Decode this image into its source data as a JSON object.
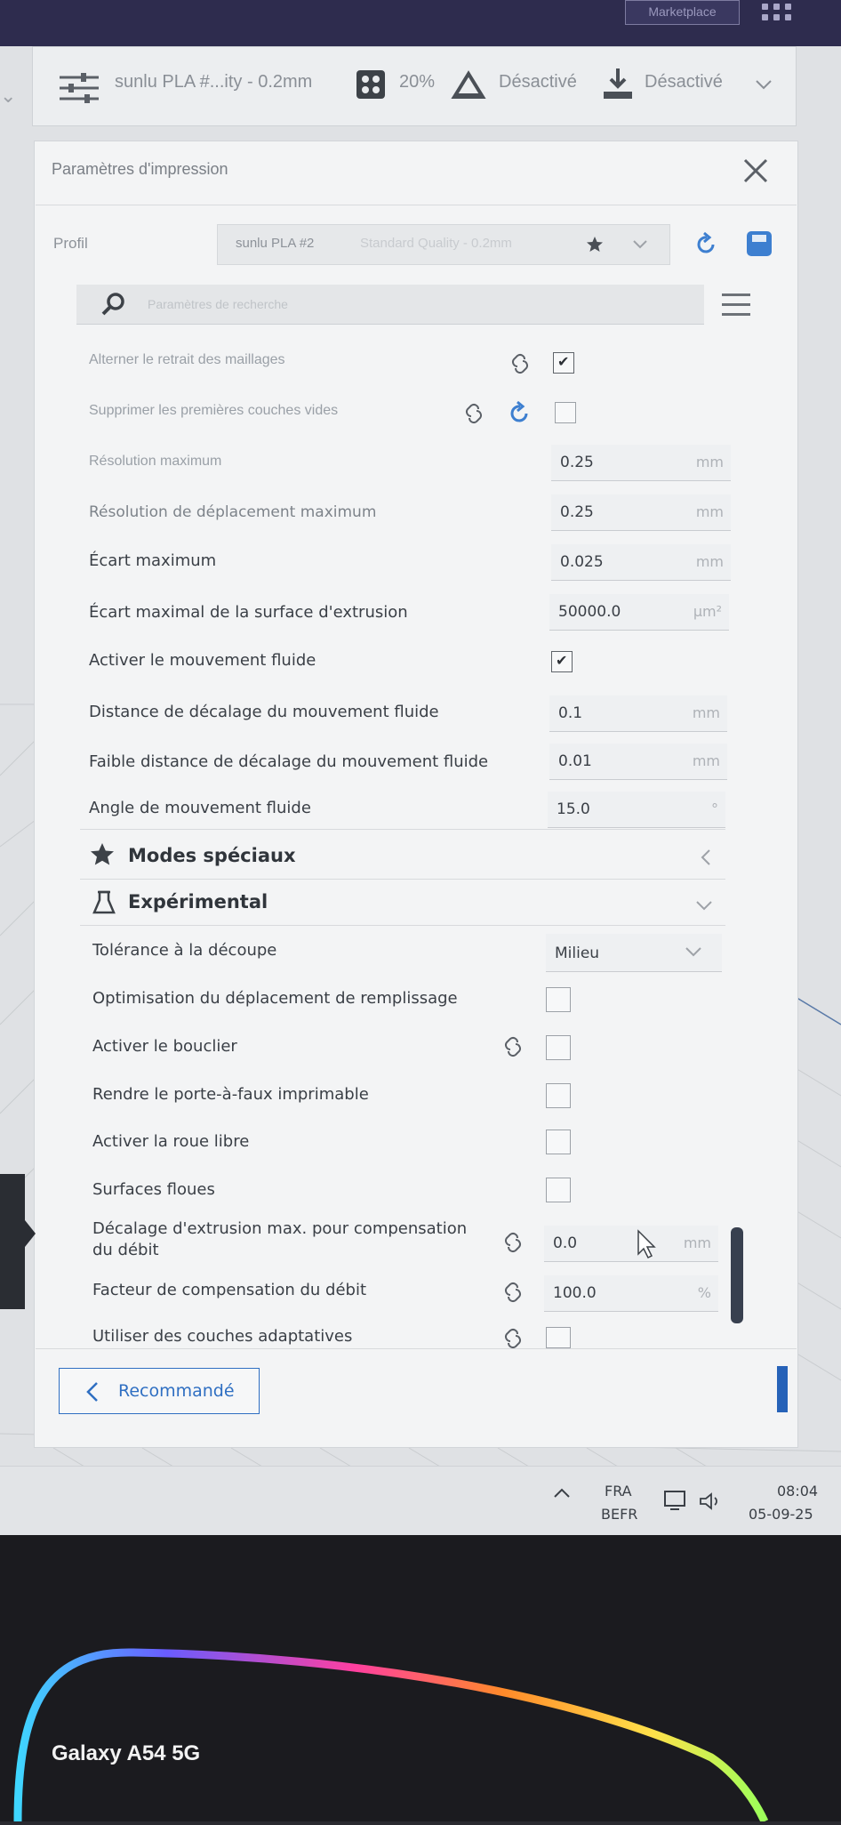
{
  "topbar": {
    "marketplace_label": "Marketplace"
  },
  "header": {
    "profile_summary": "sunlu PLA #...ity - 0.2mm",
    "infill": "20%",
    "support": "Désactivé",
    "adhesion": "Désactivé"
  },
  "panel": {
    "title": "Paramètres d'impression",
    "profile_label": "Profil",
    "profile_value": "sunlu PLA #2",
    "profile_quality": "Standard Quality - 0.2mm",
    "search_placeholder": "Paramètres de recherche"
  },
  "settings": [
    {
      "label": "Alterner le retrait des maillages",
      "checked": true
    },
    {
      "label": "Supprimer les premières couches vides",
      "checked": false
    },
    {
      "label": "Résolution maximum",
      "value": "0.25",
      "unit": "mm"
    },
    {
      "label": "Résolution de déplacement maximum",
      "value": "0.25",
      "unit": "mm"
    },
    {
      "label": "Écart maximum",
      "value": "0.025",
      "unit": "mm"
    },
    {
      "label": "Écart maximal de la surface d'extrusion",
      "value": "50000.0",
      "unit": "µm²"
    },
    {
      "label": "Activer le mouvement fluide",
      "checked": true
    },
    {
      "label": "Distance de décalage du mouvement fluide",
      "value": "0.1",
      "unit": "mm"
    },
    {
      "label": "Faible distance de décalage du mouvement fluide",
      "value": "0.01",
      "unit": "mm"
    },
    {
      "label": "Angle de mouvement fluide",
      "value": "15.0",
      "unit": "°"
    }
  ],
  "sections": {
    "special": "Modes spéciaux",
    "experimental": "Expérimental"
  },
  "experimental": [
    {
      "label": "Tolérance à la découpe",
      "value": "Milieu"
    },
    {
      "label": "Optimisation du déplacement de remplissage",
      "checked": false
    },
    {
      "label": "Activer le bouclier",
      "checked": false
    },
    {
      "label": "Rendre le porte-à-faux imprimable",
      "checked": false
    },
    {
      "label": "Activer la roue libre",
      "checked": false
    },
    {
      "label": "Surfaces floues",
      "checked": false
    },
    {
      "label": "Décalage d'extrusion max. pour compensation du débit",
      "value": "0.0",
      "unit": "mm"
    },
    {
      "label": "Facteur de compensation du débit",
      "value": "100.0",
      "unit": "%"
    },
    {
      "label": "Utiliser des couches adaptatives",
      "checked": false
    }
  ],
  "footer": {
    "recommended_label": "Recommandé"
  },
  "taskbar": {
    "lang": "FRA",
    "layout": "BEFR",
    "time": "08:04",
    "date": "05-09-25"
  },
  "phone": {
    "label": "Galaxy A54 5G"
  },
  "colors": {
    "accent": "#2f6fc2",
    "text": "#3a3f46"
  }
}
